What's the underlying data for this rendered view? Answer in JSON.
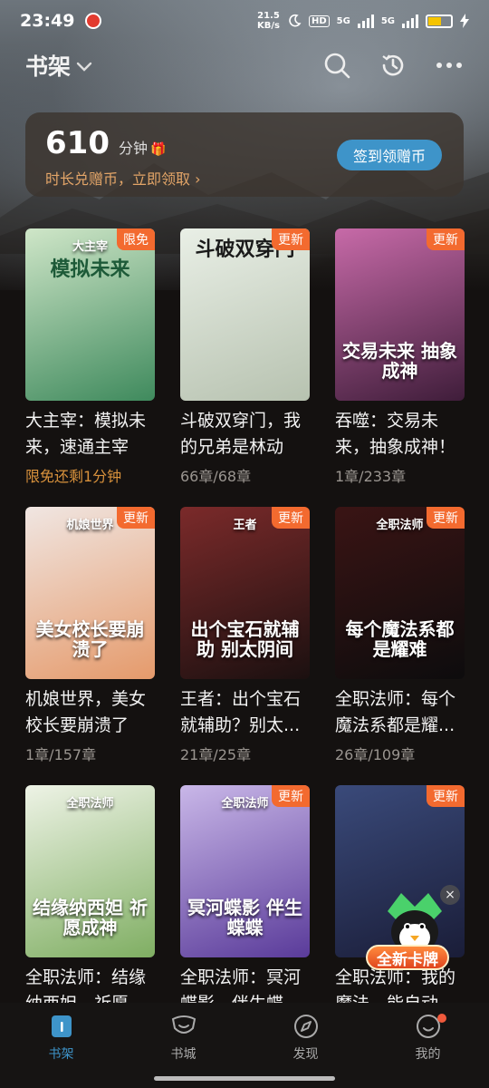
{
  "status_bar": {
    "time": "23:49",
    "speed_value": "21.5",
    "speed_unit": "KB/s",
    "hd_label": "HD",
    "net1": "5G",
    "net2": "5G"
  },
  "header": {
    "title": "书架"
  },
  "reward": {
    "minutes": "610",
    "unit": "分钟",
    "subtitle": "时长兑赠币，立即领取 ›",
    "button": "签到领赠币"
  },
  "books": [
    {
      "cover_top": "大主宰",
      "cover_title": "模拟未来",
      "badge": "限免",
      "title": "大主宰：模拟未来，速通主宰",
      "meta": "限免还剩1分钟",
      "promo": true,
      "colors": [
        "#cfe6c8",
        "#3f8a5d"
      ]
    },
    {
      "cover_top": "",
      "cover_title": "斗破双穿门",
      "badge": "更新",
      "title": "斗破双穿门，我的兄弟是林动",
      "meta": "66章/68章",
      "promo": false,
      "colors": [
        "#e9efe6",
        "#b7c2b0"
      ]
    },
    {
      "cover_top": "",
      "cover_title": "交易未来 抽象成神",
      "badge": "更新",
      "title": "吞噬：交易未来，抽象成神！",
      "meta": "1章/233章",
      "promo": false,
      "colors": [
        "#c76aa8",
        "#3f1d3a"
      ]
    },
    {
      "cover_top": "机娘世界",
      "cover_title": "美女校长要崩溃了",
      "badge": "更新",
      "title": "机娘世界，美女校长要崩溃了",
      "meta": "1章/157章",
      "promo": false,
      "colors": [
        "#f0e6e2",
        "#e59a6b"
      ]
    },
    {
      "cover_top": "王者",
      "cover_title": "出个宝石就辅助 别太阴间",
      "badge": "更新",
      "title": "王者：出个宝石就辅助？别太...",
      "meta": "21章/25章",
      "promo": false,
      "colors": [
        "#7b2a2a",
        "#1b1010"
      ]
    },
    {
      "cover_top": "全职法师",
      "cover_title": "每个魔法系都是耀难",
      "badge": "更新",
      "title": "全职法师：每个魔法系都是耀...",
      "meta": "26章/109章",
      "promo": false,
      "colors": [
        "#3a1414",
        "#0d0c0d"
      ]
    },
    {
      "cover_top": "全职法师",
      "cover_title": "结缘纳西妲 祈愿成神",
      "badge": "",
      "title": "全职法师：结缘纳西妲，祈愿...",
      "meta": "",
      "promo": false,
      "colors": [
        "#eef3e6",
        "#7fae62"
      ]
    },
    {
      "cover_top": "全职法师",
      "cover_title": "冥河蝶影 伴生蝶蝶",
      "badge": "更新",
      "title": "全职法师：冥河蝶影，伴生蝶蝶...",
      "meta": "",
      "promo": false,
      "colors": [
        "#c9b7e8",
        "#5a3b9a"
      ]
    },
    {
      "cover_top": "",
      "cover_title": "",
      "badge": "更新",
      "title": "全职法师：我的魔法，能自动...",
      "meta": "",
      "promo": false,
      "colors": [
        "#3a4a7a",
        "#1a1d38"
      ]
    }
  ],
  "float_card": {
    "label": "全新卡牌",
    "close": "×"
  },
  "nav": {
    "items": [
      {
        "label": "书架",
        "icon": "bookshelf-icon",
        "active": true
      },
      {
        "label": "书城",
        "icon": "bookstore-icon",
        "active": false
      },
      {
        "label": "发现",
        "icon": "discover-icon",
        "active": false
      },
      {
        "label": "我的",
        "icon": "profile-icon",
        "active": false
      }
    ]
  },
  "colors": {
    "accent": "#3e94c9",
    "badge": "#f36a2f",
    "promo": "#d9923c"
  }
}
